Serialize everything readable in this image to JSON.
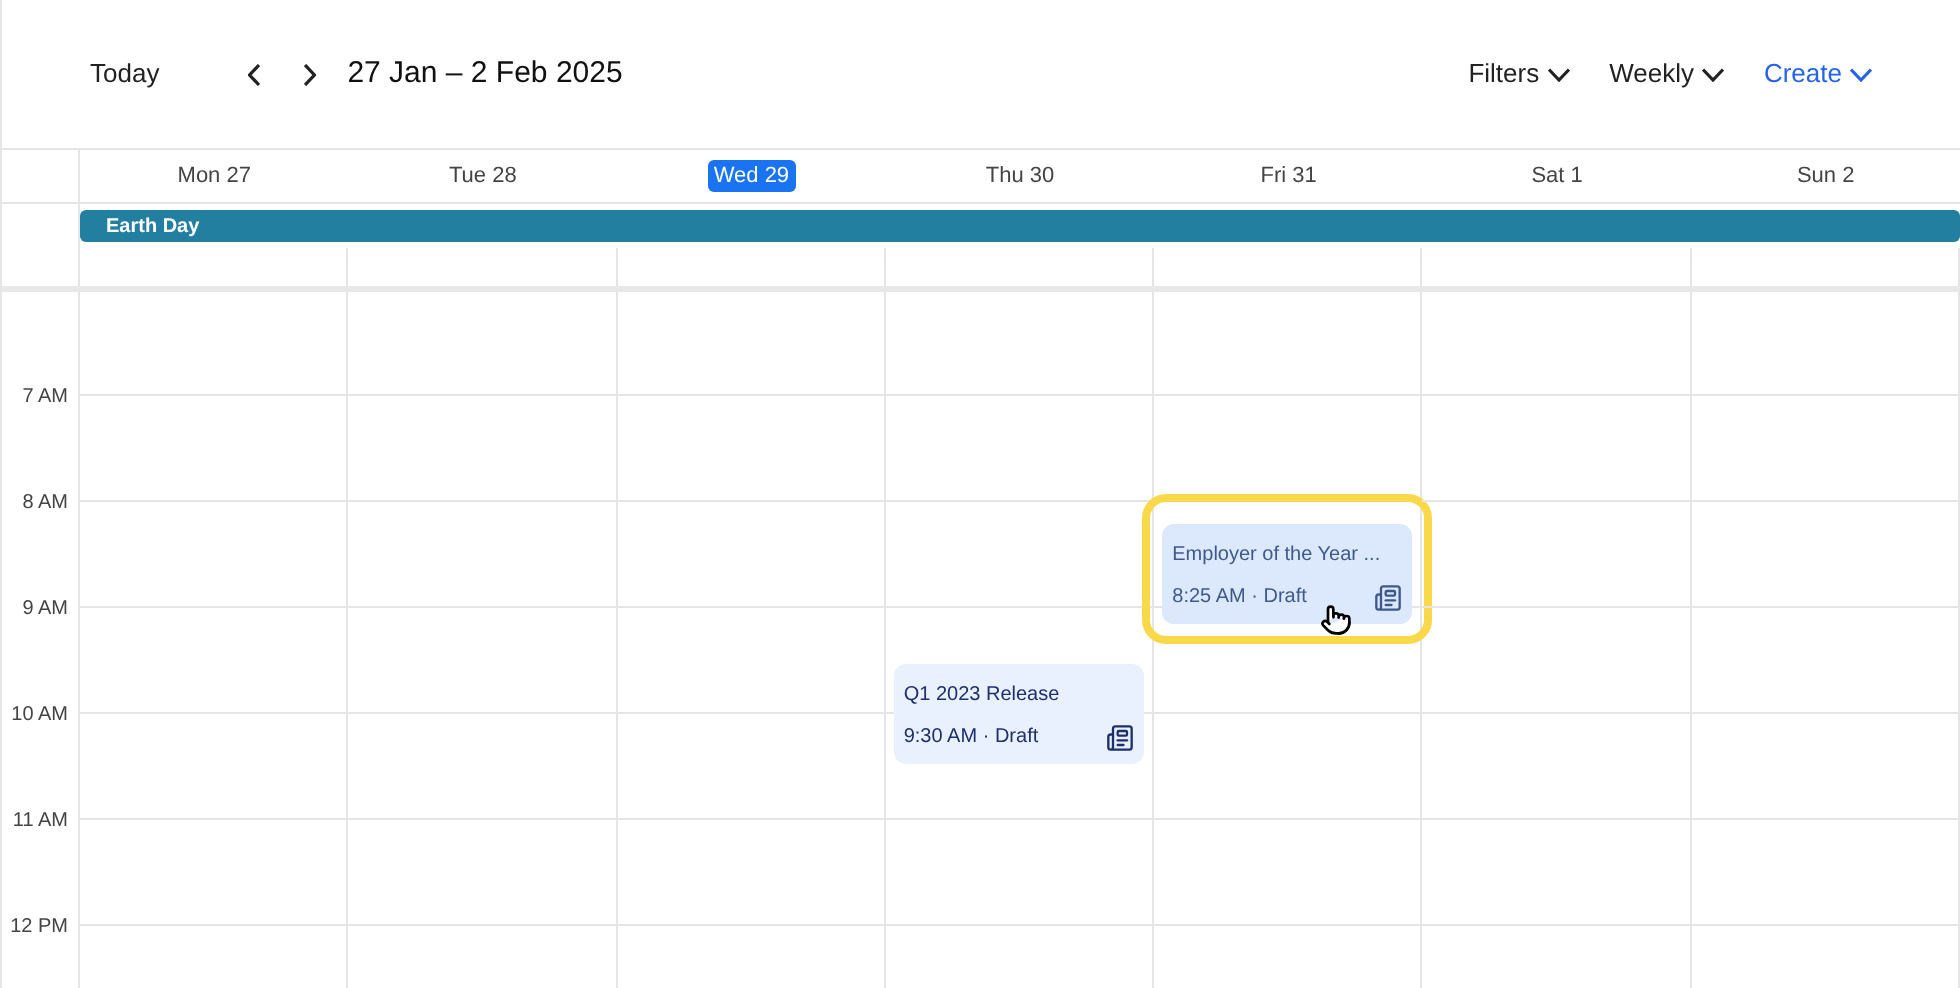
{
  "toolbar": {
    "today": "Today",
    "range": "27 Jan – 2 Feb 2025",
    "filters": "Filters",
    "view": "Weekly",
    "create": "Create"
  },
  "days": [
    {
      "label": "Mon 27",
      "selected": false
    },
    {
      "label": "Tue 28",
      "selected": false
    },
    {
      "label": "Wed 29",
      "selected": true
    },
    {
      "label": "Thu 30",
      "selected": false
    },
    {
      "label": "Fri 31",
      "selected": false
    },
    {
      "label": "Sat 1",
      "selected": false
    },
    {
      "label": "Sun 2",
      "selected": false
    }
  ],
  "all_day": [
    {
      "title": "Earth Day"
    }
  ],
  "hours": [
    "7 AM",
    "8 AM",
    "9 AM",
    "10 AM",
    "11 AM",
    "12 PM"
  ],
  "events": [
    {
      "title": "Q1 2023 Release",
      "time": "9:30 AM",
      "separator": "·",
      "status": "Draft",
      "highlighted": false
    },
    {
      "title": "Employer of the Year ...",
      "time": "8:25 AM",
      "separator": "·",
      "status": "Draft",
      "highlighted": true
    }
  ]
}
